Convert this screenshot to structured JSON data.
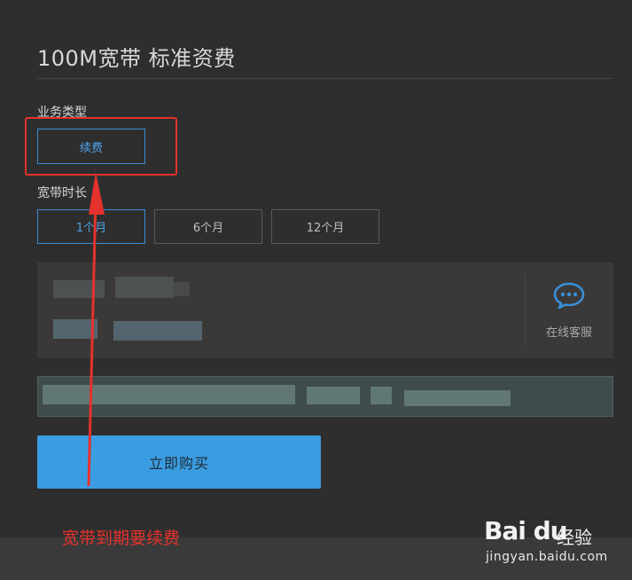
{
  "page": {
    "title": "100M宽带 标准资费"
  },
  "service_type": {
    "label": "业务类型",
    "options": [
      {
        "label": "续费",
        "selected": true
      }
    ]
  },
  "duration": {
    "label": "宽带时长",
    "options": [
      {
        "label": "1个月",
        "selected": true
      },
      {
        "label": "6个月",
        "selected": false
      },
      {
        "label": "12个月",
        "selected": false
      }
    ]
  },
  "support": {
    "label": "在线客服",
    "icon": "chat-bubble-icon"
  },
  "actions": {
    "buy_label": "立即购买"
  },
  "annotation": {
    "text": "宽带到期要续费",
    "color": "#e5322d"
  },
  "watermark": {
    "logo": "Bai du",
    "cn": "经验",
    "url": "jingyan.baidu.com"
  },
  "colors": {
    "accent": "#3a9de2",
    "annotation": "#e5322d",
    "background": "#2e2e2e"
  }
}
